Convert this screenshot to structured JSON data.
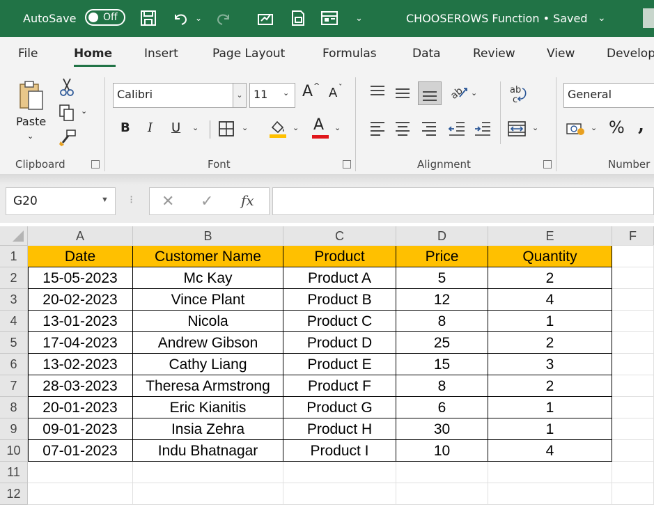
{
  "titlebar": {
    "autosave_label": "AutoSave",
    "autosave_state": "Off",
    "doc_title": "CHOOSEROWS Function • Saved",
    "bg_color": "#217346"
  },
  "tabs": [
    {
      "label": "File"
    },
    {
      "label": "Home"
    },
    {
      "label": "Insert"
    },
    {
      "label": "Page Layout"
    },
    {
      "label": "Formulas"
    },
    {
      "label": "Data"
    },
    {
      "label": "Review"
    },
    {
      "label": "View"
    },
    {
      "label": "Develop"
    }
  ],
  "ribbon": {
    "clipboard": {
      "label": "Clipboard",
      "paste_label": "Paste"
    },
    "font": {
      "label": "Font",
      "font_name": "Calibri",
      "font_size": "11",
      "bold": "B",
      "italic": "I",
      "underline": "U",
      "grow_font": "A",
      "shrink_font": "A",
      "font_color_letter": "A"
    },
    "alignment": {
      "label": "Alignment"
    },
    "number": {
      "label": "Number",
      "format": "General",
      "percent": "%"
    }
  },
  "formula_bar": {
    "name_box": "G20",
    "formula": ""
  },
  "sheet": {
    "columns": [
      "A",
      "B",
      "C",
      "D",
      "E",
      "F"
    ],
    "rows": [
      "1",
      "2",
      "3",
      "4",
      "5",
      "6",
      "7",
      "8",
      "9",
      "10",
      "11",
      "12"
    ],
    "header_color": "#ffc000",
    "table": [
      [
        "Date",
        "Customer Name",
        "Product",
        "Price",
        "Quantity"
      ],
      [
        "15-05-2023",
        "Mc Kay",
        "Product A",
        "5",
        "2"
      ],
      [
        "20-02-2023",
        "Vince Plant",
        "Product B",
        "12",
        "4"
      ],
      [
        "13-01-2023",
        "Nicola",
        "Product C",
        "8",
        "1"
      ],
      [
        "17-04-2023",
        "Andrew Gibson",
        "Product D",
        "25",
        "2"
      ],
      [
        "13-02-2023",
        "Cathy Liang",
        "Product E",
        "15",
        "3"
      ],
      [
        "28-03-2023",
        "Theresa Armstrong",
        "Product F",
        "8",
        "2"
      ],
      [
        "20-01-2023",
        "Eric Kianitis",
        "Product G",
        "6",
        "1"
      ],
      [
        "09-01-2023",
        "Insia Zehra",
        "Product H",
        "30",
        "1"
      ],
      [
        "07-01-2023",
        "Indu Bhatnagar",
        "Product I",
        "10",
        "4"
      ]
    ]
  }
}
